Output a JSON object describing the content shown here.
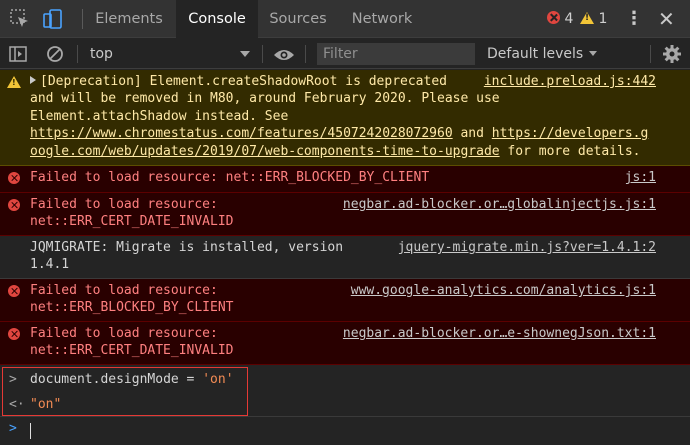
{
  "tabs": [
    {
      "label": "Elements"
    },
    {
      "label": "Console",
      "active": true
    },
    {
      "label": "Sources"
    },
    {
      "label": "Network"
    }
  ],
  "status": {
    "error_count": "4",
    "warning_count": "1"
  },
  "toolbar": {
    "context": "top",
    "filter_placeholder": "Filter",
    "levels": "Default levels"
  },
  "messages": [
    {
      "level": "warning",
      "text_before": "[Deprecation] Element.createShadowRoot is deprecated and will be removed in M80, around February 2020. Please use Element.attachShadow instead. See ",
      "link1": "https://www.chromestatus.com/features/4507242028072960",
      "text_mid": " and ",
      "link2": "https://developers.google.com/web/updates/2019/07/web-components-time-to-upgrade",
      "text_after": " for more details.",
      "source": "include.preload.js:442"
    },
    {
      "level": "error",
      "text": "Failed to load resource: net::ERR_BLOCKED_BY_CLIENT",
      "source": "js:1"
    },
    {
      "level": "error",
      "text": "Failed to load resource: net::ERR_CERT_DATE_INVALID",
      "source": "negbar.ad-blocker.or…globalinjectjs.js:1"
    },
    {
      "level": "log",
      "text": "JQMIGRATE: Migrate is installed, version 1.4.1",
      "source": "jquery-migrate.min.js?ver=1.4.1:2"
    },
    {
      "level": "error",
      "text": "Failed to load resource: net::ERR_BLOCKED_BY_CLIENT",
      "source": "www.google-analytics.com/analytics.js:1"
    },
    {
      "level": "error",
      "text": "Failed to load resource: net::ERR_CERT_DATE_INVALID",
      "source": "negbar.ad-blocker.or…e-shownegJson.txt:1"
    }
  ],
  "command": {
    "object": "document",
    "dot": ".",
    "property": "designMode",
    "operator": " = ",
    "value": "'on'"
  },
  "result": "\"on\"",
  "colors": {
    "warning_bg": "#332b00",
    "error_bg": "#290000",
    "error_text": "#ff8080",
    "warning_text": "#ffe9a8",
    "string": "#f28b54",
    "highlight_box": "#e53935"
  }
}
